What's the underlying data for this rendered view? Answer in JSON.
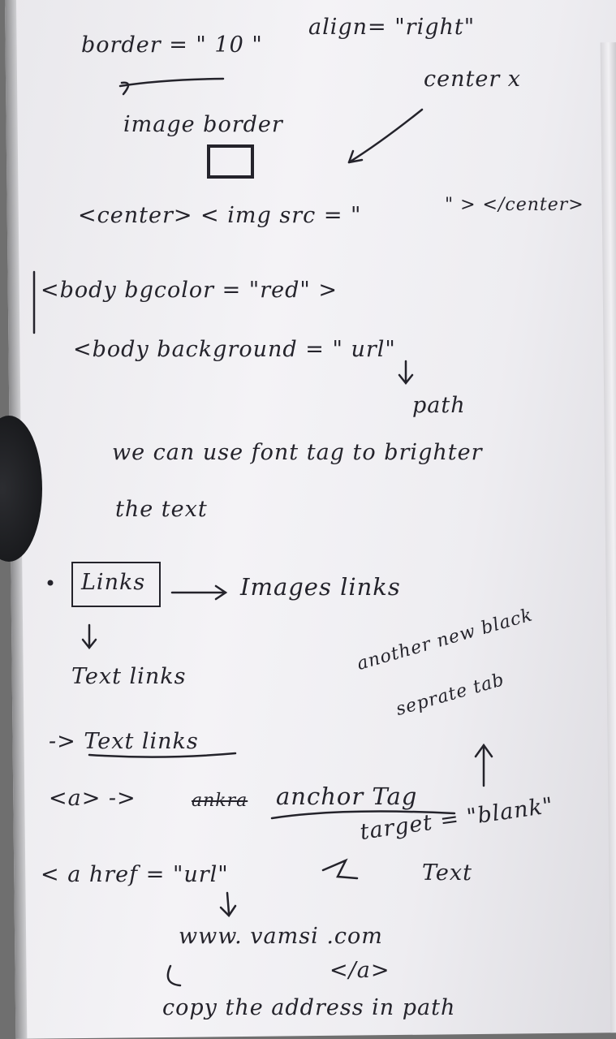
{
  "notes": {
    "line01": "border = \" 10 \"",
    "line01b": "align= \"right\"",
    "line02": "center x",
    "line03": "image border",
    "line04": "<center> < img src = \"",
    "line04b": "\" > </center>",
    "line05": "<body bgcolor = \"red\" >",
    "line06": "<body background = \" url\"",
    "line07": "path",
    "line08": "we can use font tag to brighter",
    "line09": "the text",
    "line10": "Links",
    "line10b": "Images links",
    "line11": "Text links",
    "line12": "another new black",
    "line13": "seprate tab",
    "line14": "-> Text links",
    "line15": "<a> ->",
    "line15b": "ankra",
    "line15c": "anchor Tag",
    "line16": "target = \"blank\"",
    "line17": "< a href = \"url\"",
    "line17b": "Text",
    "line18": "www. vamsi .com",
    "line19": "</a>",
    "line20": "copy the address in path"
  }
}
